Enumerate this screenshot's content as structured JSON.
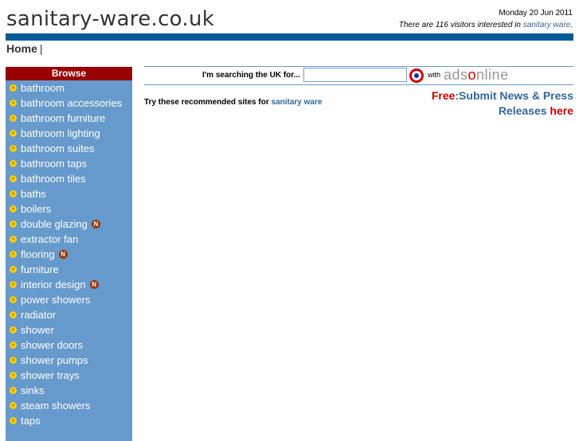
{
  "header": {
    "site_title": "sanitary-ware.co.uk",
    "date": "Monday 20 Jun 2011",
    "visitors_prefix": "There are 116 visitors interested in",
    "visitors_link": "sanitary ware",
    "visitors_suffix": "."
  },
  "nav": {
    "home": "Home",
    "separator": "|"
  },
  "sidebar": {
    "heading": "Browse",
    "items": [
      {
        "label": "bathroom",
        "new": false
      },
      {
        "label": "bathroom accessories",
        "new": false
      },
      {
        "label": "bathroom furniture",
        "new": false
      },
      {
        "label": "bathroom lighting",
        "new": false
      },
      {
        "label": "bathroom suites",
        "new": false
      },
      {
        "label": "bathroom taps",
        "new": false
      },
      {
        "label": "bathroom tiles",
        "new": false
      },
      {
        "label": "baths",
        "new": false
      },
      {
        "label": "boilers",
        "new": false
      },
      {
        "label": "double glazing",
        "new": true
      },
      {
        "label": "extractor fan",
        "new": false
      },
      {
        "label": "flooring",
        "new": true
      },
      {
        "label": "furniture",
        "new": false
      },
      {
        "label": "interior design",
        "new": true
      },
      {
        "label": "power showers",
        "new": false
      },
      {
        "label": "radiator",
        "new": false
      },
      {
        "label": "shower",
        "new": false
      },
      {
        "label": "shower doors",
        "new": false
      },
      {
        "label": "shower pumps",
        "new": false
      },
      {
        "label": "shower trays",
        "new": false
      },
      {
        "label": "sinks",
        "new": false
      },
      {
        "label": "steam showers",
        "new": false
      },
      {
        "label": "taps",
        "new": false
      }
    ],
    "new_badge": "N"
  },
  "search": {
    "label": "I'm searching the UK for...",
    "value": "",
    "with": "with",
    "logo_a": "ads",
    "logo_o": "o",
    "logo_b": "nline"
  },
  "main": {
    "recommend_text": "Try these recommended sites for",
    "recommend_link": "sanitary ware",
    "press_free": "Free",
    "press_mid": ":Submit News & Press Releases",
    "press_here": "here"
  },
  "colors": {
    "topbar": "#005a96",
    "sidebar": "#6699cc",
    "sidebar_head": "#990000",
    "link": "#336699",
    "accent_red": "#cc0000"
  }
}
